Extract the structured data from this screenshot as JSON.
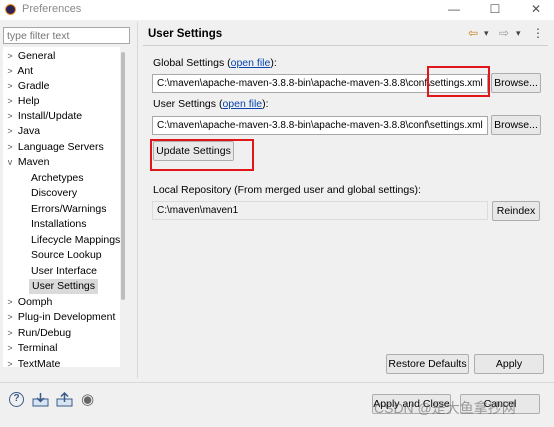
{
  "window": {
    "title": "Preferences",
    "min_glyph": "—",
    "max_glyph": "☐",
    "close_glyph": "✕"
  },
  "filter": {
    "placeholder": "type filter text"
  },
  "tree": [
    {
      "label": "General",
      "expander": ">"
    },
    {
      "label": "Ant",
      "expander": ">"
    },
    {
      "label": "Gradle",
      "expander": ">"
    },
    {
      "label": "Help",
      "expander": ">"
    },
    {
      "label": "Install/Update",
      "expander": ">"
    },
    {
      "label": "Java",
      "expander": ">"
    },
    {
      "label": "Language Servers",
      "expander": ">"
    },
    {
      "label": "Maven",
      "expander": "v"
    },
    {
      "label": "Archetypes"
    },
    {
      "label": "Discovery"
    },
    {
      "label": "Errors/Warnings"
    },
    {
      "label": "Installations"
    },
    {
      "label": "Lifecycle Mappings"
    },
    {
      "label": "Source Lookup"
    },
    {
      "label": "User Interface"
    },
    {
      "label": "User Settings",
      "selected": true
    },
    {
      "label": "Oomph",
      "expander": ">"
    },
    {
      "label": "Plug-in Development",
      "expander": ">"
    },
    {
      "label": "Run/Debug",
      "expander": ">"
    },
    {
      "label": "Terminal",
      "expander": ">"
    },
    {
      "label": "TextMate",
      "expander": ">"
    }
  ],
  "page": {
    "title": "User Settings",
    "nav": {
      "back_glyph": "⇦",
      "forward_glyph": "⇨",
      "menu_glyph": "⋮",
      "dropdown_glyph": "▾"
    },
    "global": {
      "label_prefix": "Global Settings (",
      "link": "open file",
      "label_suffix": "):",
      "value": "C:\\maven\\apache-maven-3.8.8-bin\\apache-maven-3.8.8\\conf\\settings.xml",
      "browse": "Browse..."
    },
    "user": {
      "label_prefix": "User Settings (",
      "link": "open file",
      "label_suffix": "):",
      "value": "C:\\maven\\apache-maven-3.8.8-bin\\apache-maven-3.8.8\\conf\\settings.xml",
      "browse": "Browse..."
    },
    "update_button": "Update Settings",
    "local_repo": {
      "label": "Local Repository (From merged user and global settings):",
      "value": "C:\\maven\\maven1",
      "reindex": "Reindex"
    },
    "restore_defaults": "Restore Defaults",
    "apply": "Apply"
  },
  "footer": {
    "apply_close": "Apply and Close",
    "cancel": "Cancel",
    "help_glyph": "?",
    "record_glyph": "◉"
  },
  "watermark": "CSDN @是大鱼拿抄网",
  "accent_colors": {
    "highlight_box": "#e0161b",
    "link": "#0645ad",
    "selection": "#dadada"
  }
}
